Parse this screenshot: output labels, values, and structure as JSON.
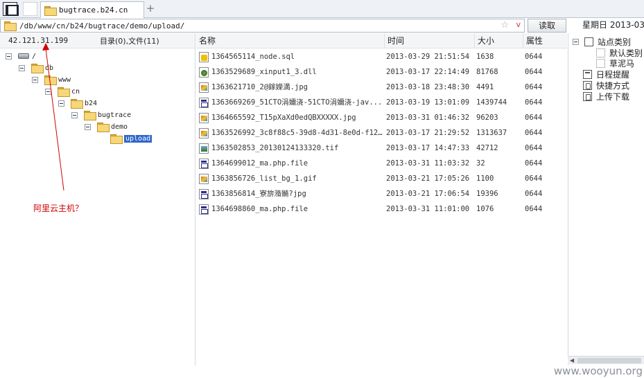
{
  "tabbar": {
    "active_tab": "bugtrace.b24.cn",
    "add_label": "+"
  },
  "address": {
    "path": "/db/www/cn/b24/bugtrace/demo/upload/",
    "star": "☆",
    "chevron": "v"
  },
  "toolbar": {
    "read_button": "读取",
    "date_text": "星期日 2013-03-"
  },
  "left": {
    "ip": "42.121.31.199",
    "counts": "目录(0),文件(11)",
    "tree": [
      {
        "label": "/",
        "icon": "drive-icon"
      },
      {
        "label": "db",
        "icon": "folder-icon"
      },
      {
        "label": "www",
        "icon": "folder-icon"
      },
      {
        "label": "cn",
        "icon": "folder-icon"
      },
      {
        "label": "b24",
        "icon": "folder-icon"
      },
      {
        "label": "bugtrace",
        "icon": "folder-icon"
      },
      {
        "label": "demo",
        "icon": "folder-icon"
      },
      {
        "label": "upload",
        "icon": "folder-icon",
        "selected": true
      }
    ],
    "annotation": "阿里云主机？",
    "annotation_color": "#d10000"
  },
  "table": {
    "headers": {
      "name": "名称",
      "time": "时间",
      "size": "大小",
      "attr": "属性"
    },
    "rows": [
      {
        "name": "1364565114_node.sql",
        "time": "2013-03-29 21:51:54",
        "size": "1638",
        "attr": "0644",
        "icon": "sql"
      },
      {
        "name": "1363529689_xinput1_3.dll",
        "time": "2013-03-17 22:14:49",
        "size": "81768",
        "attr": "0644",
        "icon": "dll"
      },
      {
        "name": "1363621710_2@鎵嬫満.jpg",
        "time": "2013-03-18 23:48:30",
        "size": "4491",
        "attr": "0644",
        "icon": "img"
      },
      {
        "name": "1363669269_51CTO涓嬭浇-51CTO涓嬭浇-jav...",
        "time": "2013-03-19 13:01:09",
        "size": "1439744",
        "attr": "0644",
        "icon": "exe"
      },
      {
        "name": "1364665592_T15pXaXd0edQBXXXXX.jpg",
        "time": "2013-03-31 01:46:32",
        "size": "96203",
        "attr": "0644",
        "icon": "img"
      },
      {
        "name": "1363526992_3c8f88c5-39d8-4d31-8e0d-f12...",
        "time": "2013-03-17 21:29:52",
        "size": "1313637",
        "attr": "0644",
        "icon": "img"
      },
      {
        "name": "1363502853_20130124133320.tif",
        "time": "2013-03-17 14:47:33",
        "size": "42712",
        "attr": "0644",
        "icon": "tif"
      },
      {
        "name": "1364699012_ma.php.file",
        "time": "2013-03-31 11:03:32",
        "size": "32",
        "attr": "0644",
        "icon": "exe"
      },
      {
        "name": "1363856726_list_bg_1.gif",
        "time": "2013-03-21 17:05:26",
        "size": "1100",
        "attr": "0644",
        "icon": "img"
      },
      {
        "name": "1363856814_寮旂潃鏅?jpg",
        "time": "2013-03-21 17:06:54",
        "size": "19396",
        "attr": "0644",
        "icon": "exe"
      },
      {
        "name": "1364698860_ma.php.file",
        "time": "2013-03-31 11:01:00",
        "size": "1076",
        "attr": "0644",
        "icon": "exe"
      }
    ]
  },
  "right": {
    "items": [
      {
        "label": "站点类别",
        "icon": "category-box-icon"
      },
      {
        "label": "默认类别",
        "icon": "dotted-box-icon"
      },
      {
        "label": "草泥马",
        "icon": "dotted-box-icon"
      },
      {
        "label": "日程提醒",
        "icon": "calendar-icon"
      },
      {
        "label": "快捷方式",
        "icon": "hand-icon"
      },
      {
        "label": "上传下载",
        "icon": "upload-icon"
      }
    ]
  },
  "watermark": "www.wooyun.org"
}
